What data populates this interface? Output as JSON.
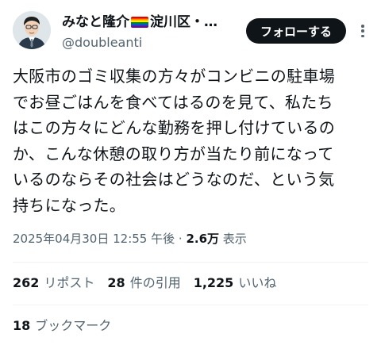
{
  "author": {
    "display_name_prefix": "みなと隆介",
    "display_name_suffix": "淀川区・…",
    "flag_icon": "rainbow-flag-icon",
    "handle": "@doubleanti",
    "avatar_icon": "user-avatar-icon"
  },
  "follow_button": {
    "label": "フォローする"
  },
  "more_icon": "more-options-icon",
  "tweet": {
    "text": "大阪市のゴミ収集の方々がコンビニの駐車場\nでお昼ごはんを食べてはるのを見て、私たち\nはこの方々にどんな勤務を押し付けているの\nか、こんな休憩の取り方が当たり前になって\nいるのならその社会はどうなのだ、という気\n持ちになった。"
  },
  "meta": {
    "timestamp": "2025年04月30日 12:55 午後",
    "separator": " · ",
    "views_count": "2.6万",
    "views_label": " 表示"
  },
  "stats": {
    "reposts": {
      "count": "262",
      "label": "リポスト"
    },
    "quotes": {
      "count": "28",
      "label": "件の引用"
    },
    "likes": {
      "count": "1,225",
      "label": "いいね"
    }
  },
  "bookmarks": {
    "count": "18",
    "label": "ブックマーク"
  },
  "colors": {
    "text_primary": "#0f1419",
    "text_secondary": "#536471",
    "button_bg": "#0f1419",
    "divider": "#eff3f4"
  }
}
